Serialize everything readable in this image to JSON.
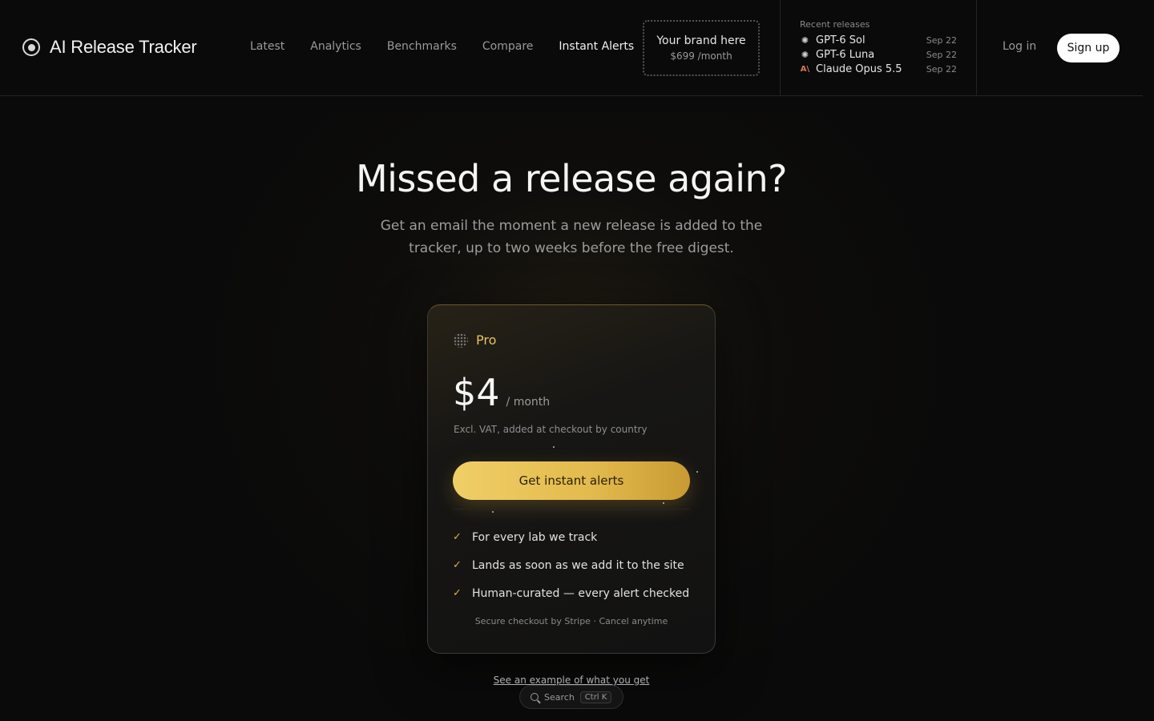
{
  "brand": {
    "name": "AI Release Tracker",
    "icon": "target-circle-icon"
  },
  "nav": [
    {
      "label": "Latest",
      "active": false
    },
    {
      "label": "Analytics",
      "active": false
    },
    {
      "label": "Benchmarks",
      "active": false
    },
    {
      "label": "Compare",
      "active": false
    },
    {
      "label": "Instant Alerts",
      "active": true
    }
  ],
  "ad": {
    "title": "Your brand here",
    "price": "$699 /month"
  },
  "recent_releases": {
    "heading": "Recent releases",
    "items": [
      {
        "name": "GPT-6 Sol",
        "date": "Sep 22",
        "icon": "openai-icon"
      },
      {
        "name": "GPT-6 Luna",
        "date": "Sep 22",
        "icon": "openai-icon"
      },
      {
        "name": "Claude Opus 5.5",
        "date": "Sep 22",
        "icon": "anthropic-icon"
      }
    ]
  },
  "auth": {
    "login": "Log in",
    "signup": "Sign up"
  },
  "hero": {
    "title": "Missed a release again?",
    "subtitle": "Get an email the moment a new release is added to the tracker, up to two weeks before the free digest."
  },
  "plan": {
    "name": "Pro",
    "price": "$4",
    "period": "/ month",
    "vat_note": "Excl. VAT, added at checkout by country",
    "cta": "Get instant alerts",
    "features": [
      "For every lab we track",
      "Lands as soon as we add it to the site",
      "Human-curated — every alert checked"
    ],
    "secure_note": "Secure checkout by Stripe · Cancel anytime"
  },
  "example_link": "See an example of what you get",
  "search": {
    "label": "Search",
    "shortcut": "Ctrl K"
  },
  "colors": {
    "accent": "#e7c35e",
    "background": "#0a0a0a",
    "cta_start": "#f0cf67",
    "cta_end": "#c99a33"
  }
}
